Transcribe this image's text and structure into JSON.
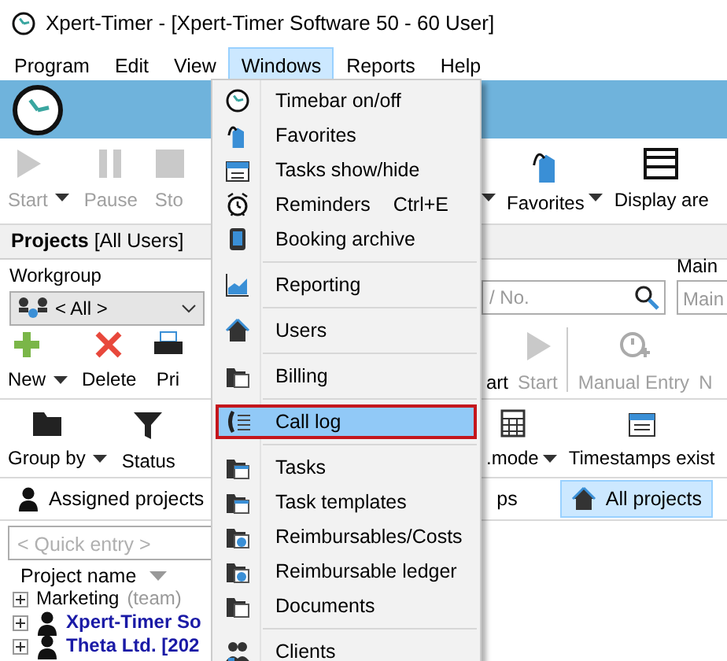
{
  "window": {
    "title": "Xpert-Timer - [Xpert-Timer Software 50 - 60 User]"
  },
  "menu_bar": [
    {
      "label": "Program",
      "selected": false
    },
    {
      "label": "Edit",
      "selected": false
    },
    {
      "label": "View",
      "selected": false
    },
    {
      "label": "Windows",
      "selected": true
    },
    {
      "label": "Reports",
      "selected": false
    },
    {
      "label": "Help",
      "selected": false
    }
  ],
  "windows_menu": [
    {
      "kind": "item",
      "label": "Timebar on/off",
      "selected": false
    },
    {
      "kind": "item",
      "label": "Favorites",
      "selected": false
    },
    {
      "kind": "item",
      "label": "Tasks show/hide",
      "selected": false
    },
    {
      "kind": "item",
      "label": "Reminders",
      "shortcut": "Ctrl+E",
      "selected": false
    },
    {
      "kind": "item",
      "label": "Booking archive",
      "selected": false
    },
    {
      "kind": "separator"
    },
    {
      "kind": "item",
      "label": "Reporting",
      "selected": false
    },
    {
      "kind": "separator"
    },
    {
      "kind": "item",
      "label": "Users",
      "selected": false
    },
    {
      "kind": "separator"
    },
    {
      "kind": "item",
      "label": "Billing",
      "selected": false
    },
    {
      "kind": "separator"
    },
    {
      "kind": "item",
      "label": "Call log",
      "selected": true
    },
    {
      "kind": "separator"
    },
    {
      "kind": "item",
      "label": "Tasks",
      "selected": false
    },
    {
      "kind": "item",
      "label": "Task templates",
      "selected": false
    },
    {
      "kind": "item",
      "label": "Reimbursables/Costs",
      "selected": false
    },
    {
      "kind": "item",
      "label": "Reimbursable ledger",
      "selected": false
    },
    {
      "kind": "item",
      "label": "Documents",
      "selected": false
    },
    {
      "kind": "separator"
    },
    {
      "kind": "item",
      "label": "Clients",
      "selected": false
    }
  ],
  "main_toolbar": {
    "left": [
      {
        "kind": "button",
        "label": "Start",
        "disabled": true,
        "dropdown": true
      },
      {
        "kind": "button",
        "label": "Pause",
        "disabled": true,
        "dropdown": false
      },
      {
        "kind": "button",
        "label": "Sto",
        "disabled": true,
        "dropdown": false
      }
    ],
    "right": [
      {
        "kind": "caret"
      },
      {
        "kind": "button",
        "label": "Favorites",
        "disabled": false,
        "dropdown": true
      },
      {
        "kind": "button",
        "label": "Display are",
        "disabled": false,
        "dropdown": false
      }
    ]
  },
  "panel": {
    "title": "**Projects** [All Users]",
    "workgroup_label": "Workgroup",
    "workgroup_value": "< All >",
    "search_placeholder": "/ No.",
    "main_label": "Main",
    "main_placeholder": "Main"
  },
  "project_toolbar": {
    "left": [
      {
        "kind": "button",
        "label": "New",
        "disabled": false,
        "dropdown": true
      },
      {
        "kind": "button",
        "label": "Delete",
        "disabled": false,
        "dropdown": false
      },
      {
        "kind": "button",
        "label": "Pri",
        "disabled": false,
        "dropdown": false
      }
    ],
    "right": [
      {
        "kind": "button",
        "label": "art",
        "disabled": false,
        "dropdown": false
      },
      {
        "kind": "button",
        "label": "Start",
        "disabled": true,
        "dropdown": false
      },
      {
        "kind": "separator"
      },
      {
        "kind": "button",
        "label": "Manual Entry",
        "disabled": true,
        "dropdown": false
      },
      {
        "kind": "button",
        "label": "N",
        "disabled": true,
        "dropdown": false
      }
    ]
  },
  "view_toolbar": {
    "left": [
      {
        "kind": "button",
        "label": "Group by",
        "disabled": false,
        "dropdown": true
      },
      {
        "kind": "button",
        "label": "Status",
        "disabled": false,
        "dropdown": false
      }
    ],
    "right": [
      {
        "kind": "button",
        "label": ".mode",
        "disabled": false,
        "dropdown": true
      },
      {
        "kind": "button",
        "label": "Timestamps exist",
        "disabled": false,
        "dropdown": false
      }
    ]
  },
  "tabs": {
    "left": [
      {
        "label": "Assigned projects",
        "selected": false
      }
    ],
    "right": [
      {
        "label": "ps",
        "selected": false
      },
      {
        "label": "All projects",
        "selected": true
      }
    ]
  },
  "quick_entry": {
    "placeholder": "< Quick entry >"
  },
  "table": {
    "column": "Project name",
    "rows": [
      {
        "kind": "group",
        "name": "Marketing",
        "note": "(team)"
      },
      {
        "kind": "client",
        "name": "Xpert-Timer So"
      },
      {
        "kind": "client",
        "name": "Theta Ltd. [202"
      }
    ]
  }
}
